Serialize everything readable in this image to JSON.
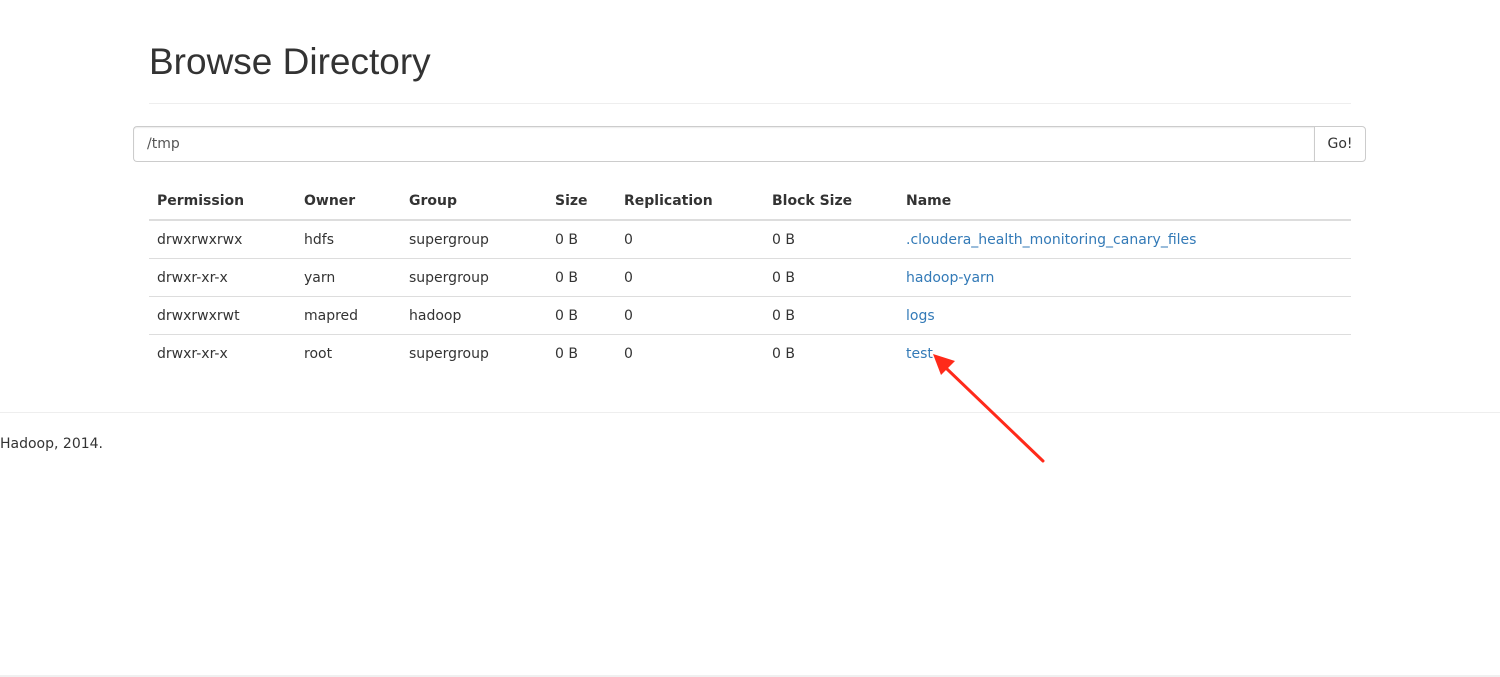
{
  "page": {
    "title": "Browse Directory"
  },
  "path_bar": {
    "value": "/tmp",
    "go_label": "Go!"
  },
  "listing": {
    "columns": [
      "Permission",
      "Owner",
      "Group",
      "Size",
      "Replication",
      "Block Size",
      "Name"
    ],
    "rows": [
      {
        "permission": "drwxrwxrwx",
        "owner": "hdfs",
        "group": "supergroup",
        "size": "0 B",
        "replication": "0",
        "block_size": "0 B",
        "name": ".cloudera_health_monitoring_canary_files"
      },
      {
        "permission": "drwxr-xr-x",
        "owner": "yarn",
        "group": "supergroup",
        "size": "0 B",
        "replication": "0",
        "block_size": "0 B",
        "name": "hadoop-yarn"
      },
      {
        "permission": "drwxrwxrwt",
        "owner": "mapred",
        "group": "hadoop",
        "size": "0 B",
        "replication": "0",
        "block_size": "0 B",
        "name": "logs"
      },
      {
        "permission": "drwxr-xr-x",
        "owner": "root",
        "group": "supergroup",
        "size": "0 B",
        "replication": "0",
        "block_size": "0 B",
        "name": "test"
      }
    ]
  },
  "footer": {
    "text": "Hadoop, 2014."
  },
  "colors": {
    "link": "#337ab7",
    "annotation_arrow": "#ff2a1a"
  }
}
